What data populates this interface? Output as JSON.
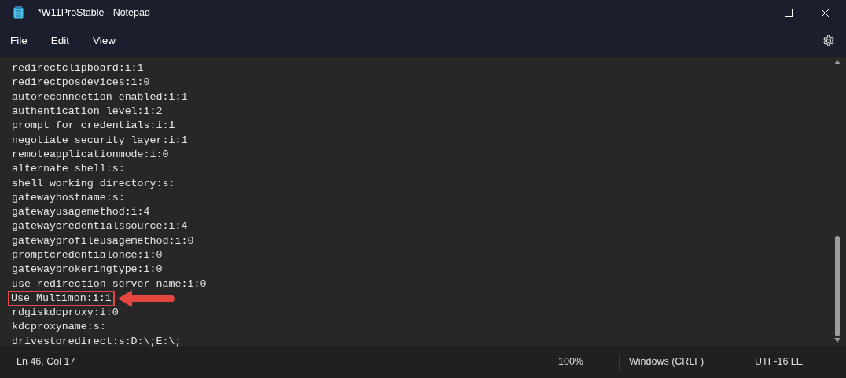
{
  "window": {
    "title": "*W11ProStable - Notepad"
  },
  "menu": [
    {
      "label": "File"
    },
    {
      "label": "Edit"
    },
    {
      "label": "View"
    }
  ],
  "editor": {
    "lines": [
      {
        "text": "redirectclipboard:i:1",
        "highlighted": false
      },
      {
        "text": "redirectposdevices:i:0",
        "highlighted": false
      },
      {
        "text": "autoreconnection enabled:i:1",
        "highlighted": false
      },
      {
        "text": "authentication level:i:2",
        "highlighted": false
      },
      {
        "text": "prompt for credentials:i:1",
        "highlighted": false
      },
      {
        "text": "negotiate security layer:i:1",
        "highlighted": false
      },
      {
        "text": "remoteapplicationmode:i:0",
        "highlighted": false
      },
      {
        "text": "alternate shell:s:",
        "highlighted": false
      },
      {
        "text": "shell working directory:s:",
        "highlighted": false
      },
      {
        "text": "gatewayhostname:s:",
        "highlighted": false
      },
      {
        "text": "gatewayusagemethod:i:4",
        "highlighted": false
      },
      {
        "text": "gatewaycredentialssource:i:4",
        "highlighted": false
      },
      {
        "text": "gatewayprofileusagemethod:i:0",
        "highlighted": false
      },
      {
        "text": "promptcredentialonce:i:0",
        "highlighted": false
      },
      {
        "text": "gatewaybrokeringtype:i:0",
        "highlighted": false
      },
      {
        "text": "use redirection server name:i:0",
        "highlighted": false
      },
      {
        "text": "Use Multimon:i:1",
        "highlighted": true
      },
      {
        "text": "rdgiskdcproxy:i:0",
        "highlighted": false
      },
      {
        "text": "kdcproxyname:s:",
        "highlighted": false
      },
      {
        "text": "drivestoredirect:s:D:\\;E:\\;",
        "highlighted": false
      }
    ]
  },
  "status_bar": {
    "position": "Ln 46, Col 17",
    "zoom": "100%",
    "line_endings": "Windows (CRLF)",
    "encoding": "UTF-16 LE"
  }
}
